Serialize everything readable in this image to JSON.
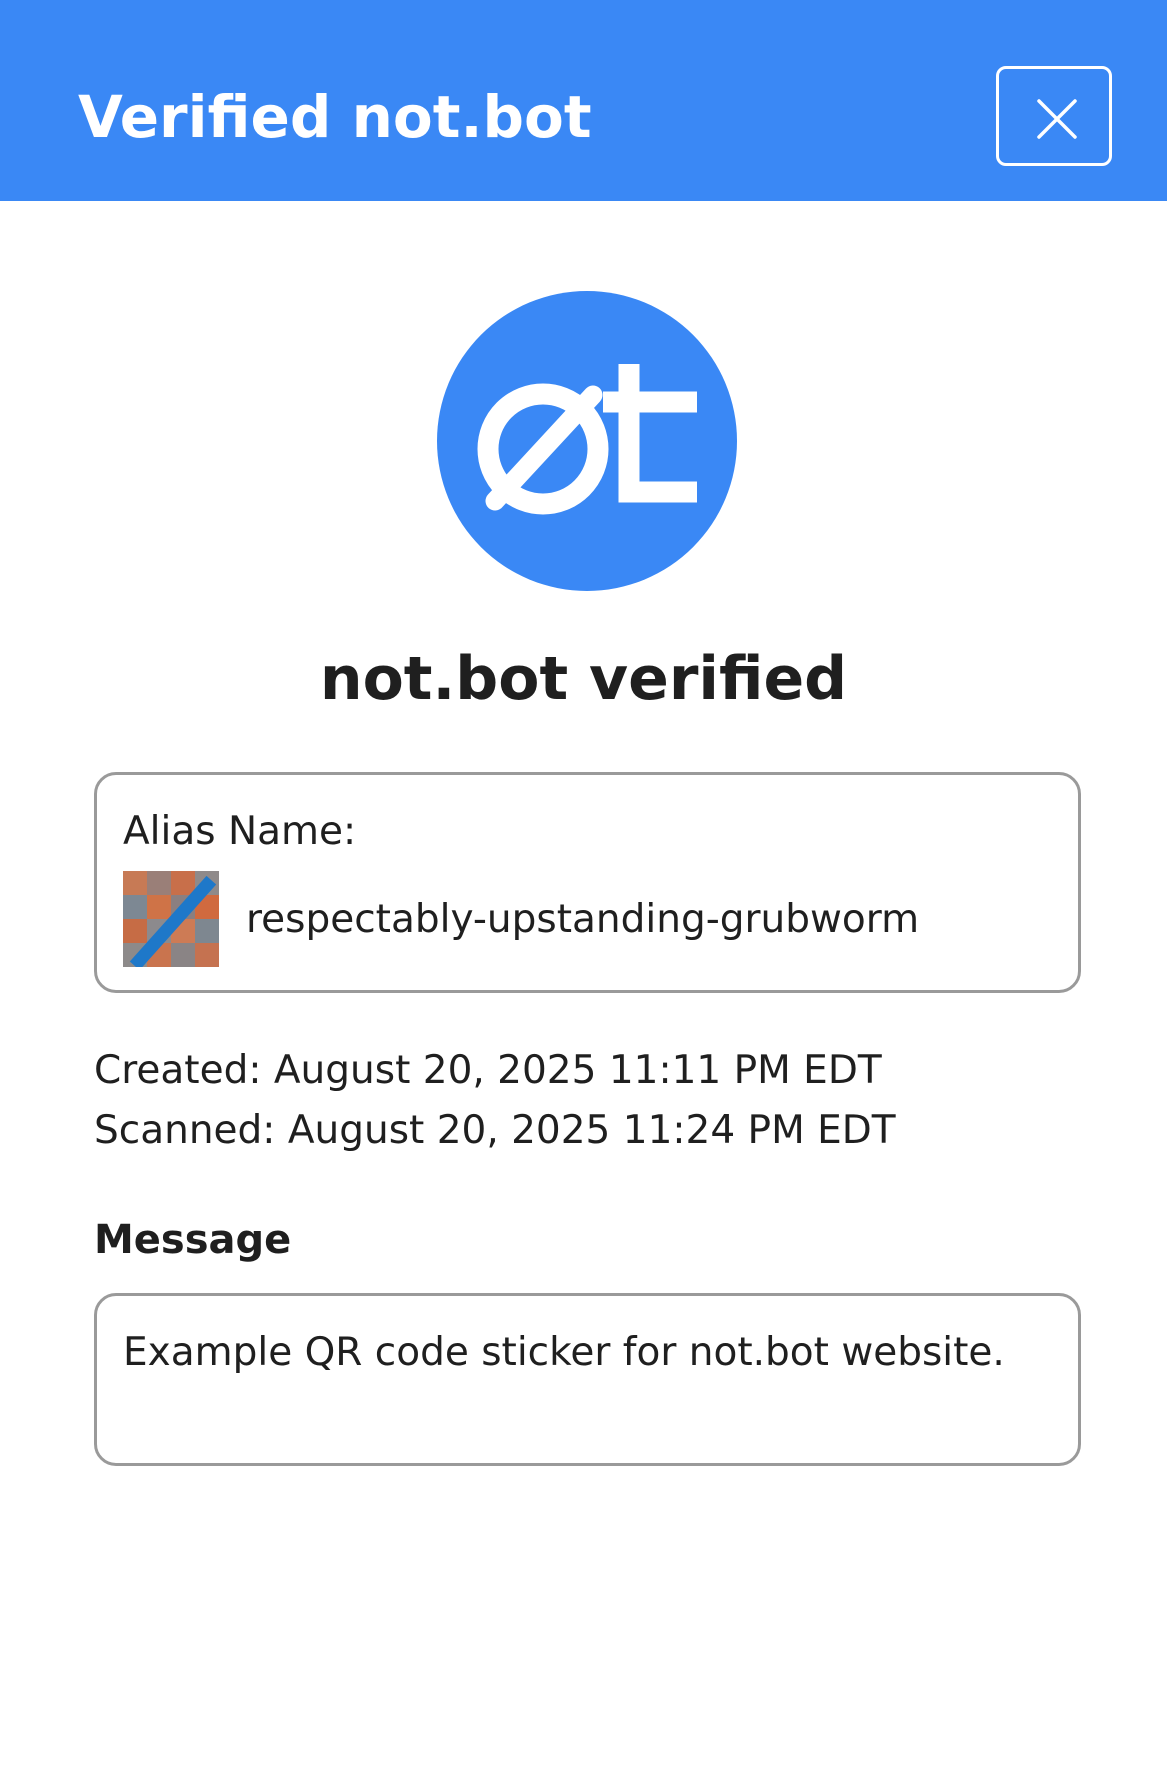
{
  "header": {
    "title": "Verified not.bot",
    "close_icon": "close-icon",
    "background_color": "#3a88f5"
  },
  "logo": {
    "icon": "not-bot-logo-icon",
    "color": "#3a88f5"
  },
  "page_title": "not.bot verified",
  "alias": {
    "label": "Alias Name:",
    "avatar_icon": "alias-avatar-image",
    "value": "respectably-upstanding-grubworm"
  },
  "meta": {
    "created": "Created: August 20, 2025 11:11 PM EDT",
    "scanned": "Scanned: August 20, 2025 11:24 PM EDT"
  },
  "message": {
    "label": "Message",
    "text": "Example QR code sticker for not.bot website."
  }
}
